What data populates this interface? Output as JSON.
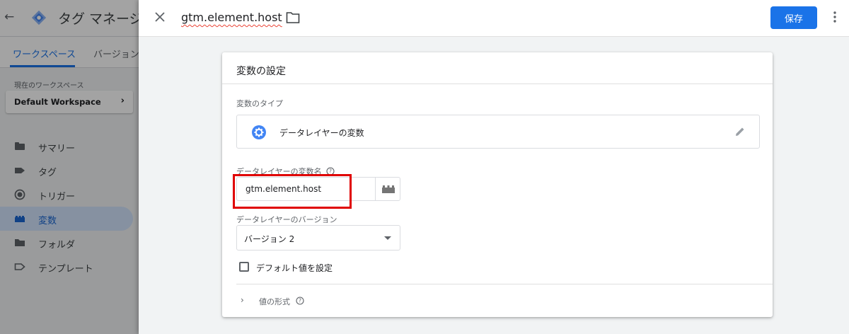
{
  "app": {
    "title": "タグ マネージャー",
    "tabs": [
      {
        "label": "ワークスペース",
        "active": true
      },
      {
        "label": "バージョン",
        "active": false
      }
    ],
    "workspace": {
      "caption": "現在のワークスペース",
      "name": "Default Workspace"
    },
    "nav": [
      {
        "label": "サマリー",
        "icon": "summary-icon",
        "active": false
      },
      {
        "label": "タグ",
        "icon": "tag-icon",
        "active": false
      },
      {
        "label": "トリガー",
        "icon": "trigger-icon",
        "active": false
      },
      {
        "label": "変数",
        "icon": "variables-icon",
        "active": true
      },
      {
        "label": "フォルダ",
        "icon": "folder-icon",
        "active": false
      },
      {
        "label": "テンプレート",
        "icon": "template-icon",
        "active": false
      }
    ]
  },
  "sheet": {
    "title": "gtm.element.host",
    "save_label": "保存"
  },
  "card": {
    "title": "変数の設定",
    "type_label": "変数のタイプ",
    "type_name": "データレイヤーの変数",
    "name_label": "データレイヤーの変数名",
    "name_value": "gtm.element.host",
    "version_label": "データレイヤーのバージョン",
    "version_value": "バージョン 2",
    "default_checkbox_label": "デフォルト値を設定",
    "format_label": "値の形式"
  },
  "colors": {
    "accent": "#1a73e8",
    "highlight": "#e00000",
    "nav_active_bg": "#d2e3fc"
  }
}
